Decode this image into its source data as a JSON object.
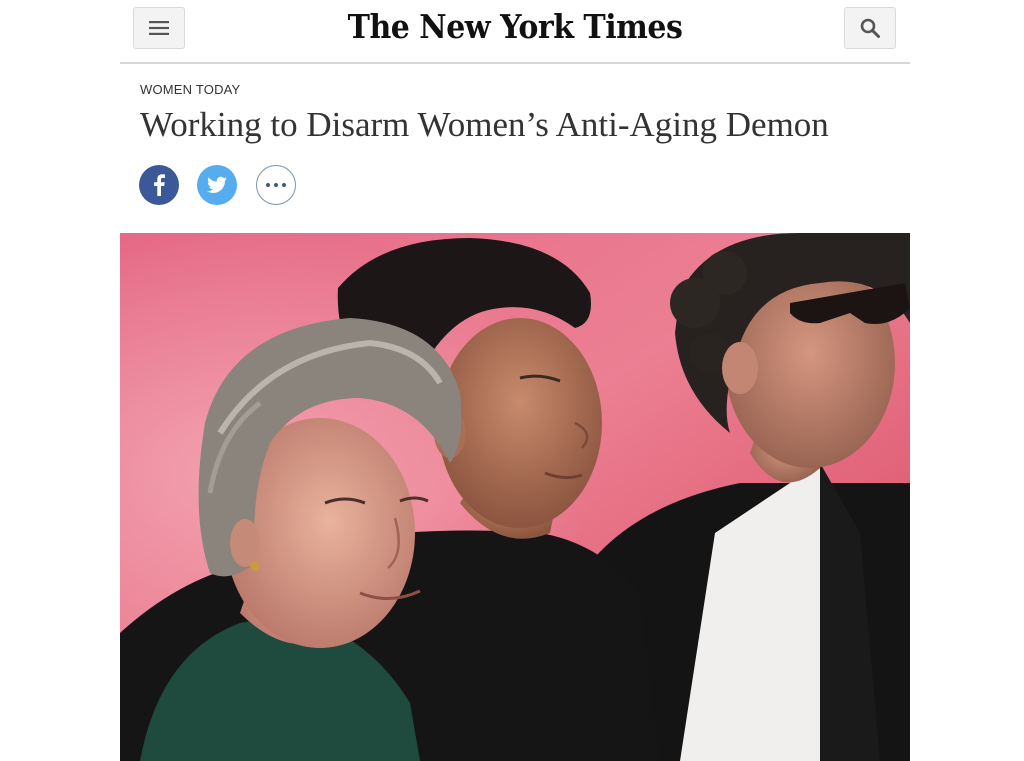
{
  "header": {
    "logo": "The New York Times",
    "menu_icon": "hamburger-menu-icon",
    "search_icon": "search-icon"
  },
  "article": {
    "kicker": "WOMEN TODAY",
    "headline": "Working to Disarm Women’s Anti-Aging Demon"
  },
  "share": {
    "facebook_icon": "facebook-icon",
    "twitter_icon": "twitter-icon",
    "more_icon": "more-options-icon"
  },
  "colors": {
    "facebook": "#3b5998",
    "twitter": "#55acee",
    "photo_background": "#e8607f"
  }
}
